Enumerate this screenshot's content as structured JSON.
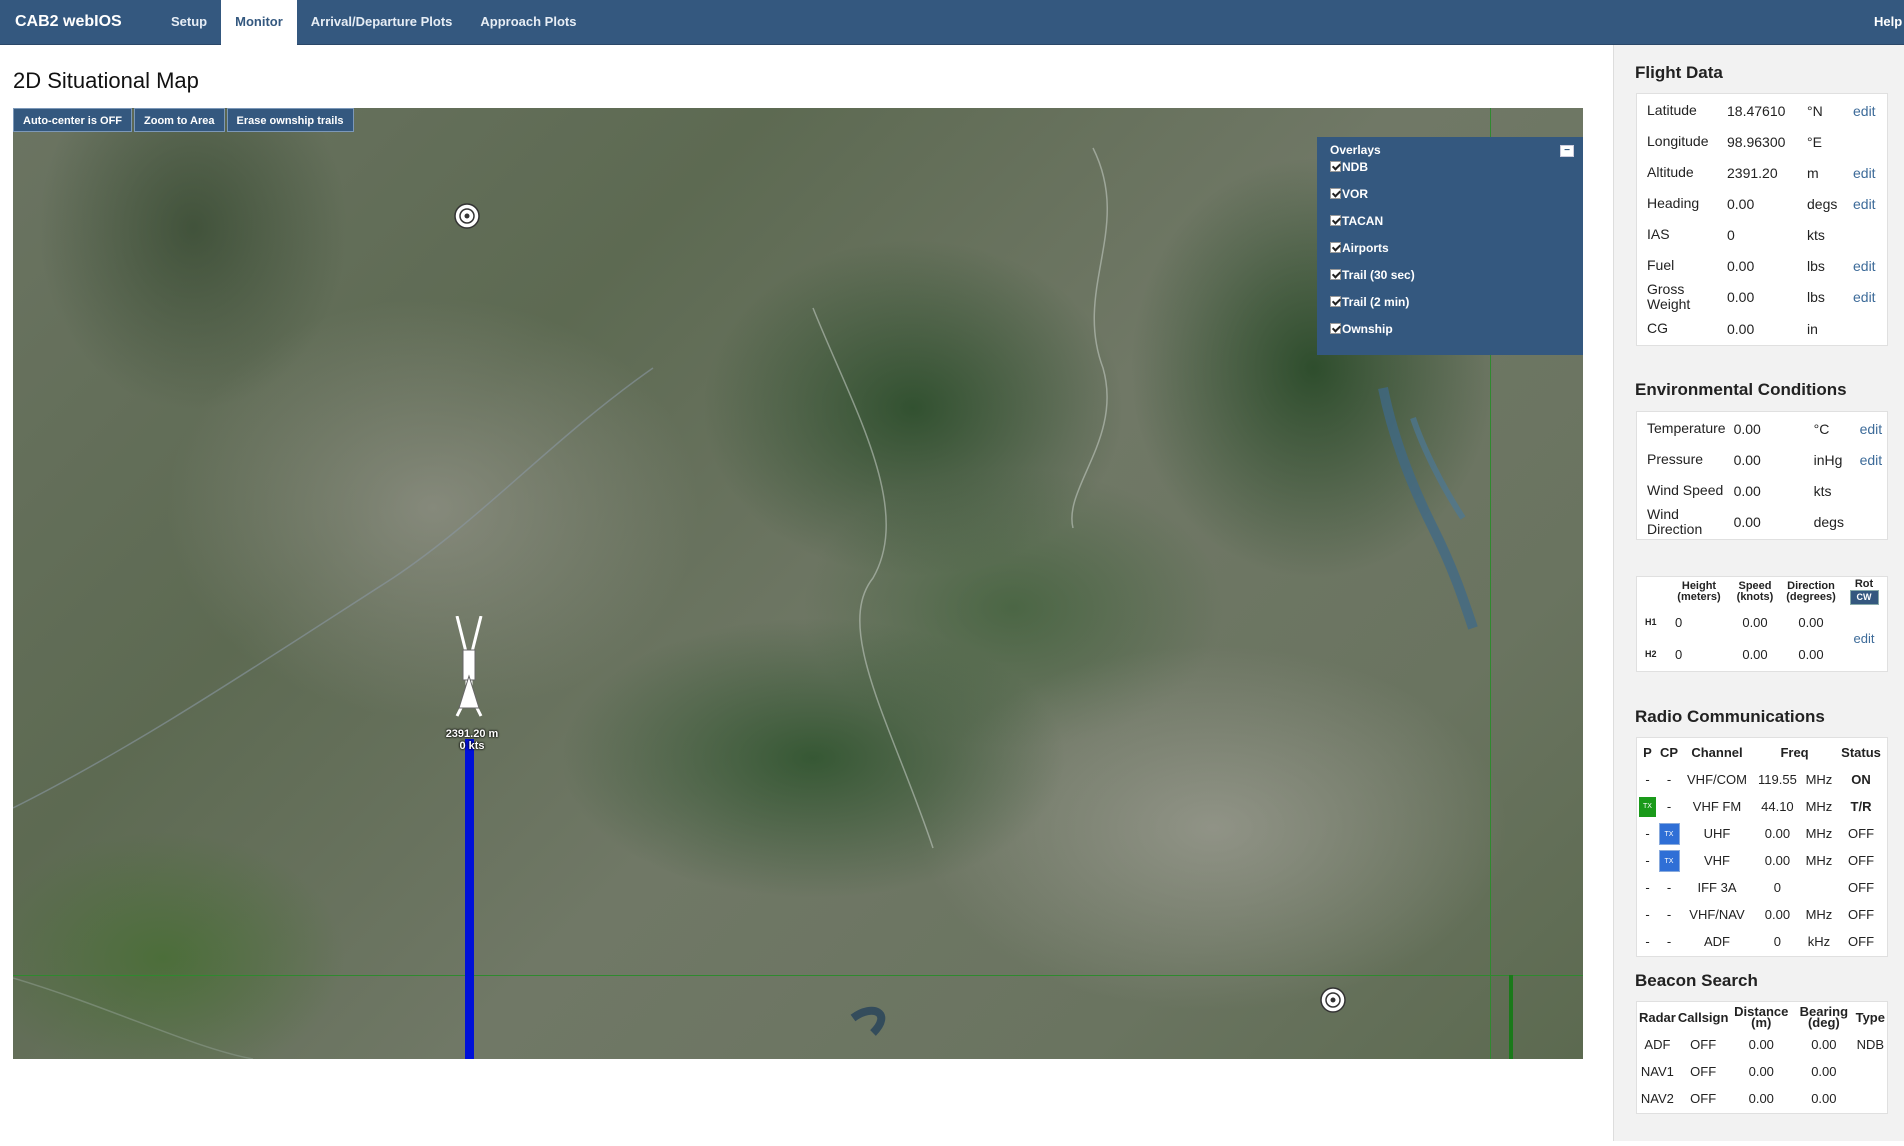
{
  "app": {
    "title": "CAB2 webIOS",
    "help": "Help"
  },
  "nav": {
    "tabs": [
      "Setup",
      "Monitor",
      "Arrival/Departure Plots",
      "Approach Plots"
    ],
    "active": "Monitor"
  },
  "page": {
    "title": "2D Situational Map"
  },
  "map": {
    "buttons": [
      "Auto-center is OFF",
      "Zoom to Area",
      "Erase ownship trails"
    ],
    "overlays": {
      "title": "Overlays",
      "items": [
        "NDB",
        "VOR",
        "TACAN",
        "Airports",
        "Trail (30 sec)",
        "Trail (2 min)",
        "Ownship"
      ]
    },
    "ownship": {
      "altitude": "2391.20 m",
      "speed": "0 kts"
    },
    "trail_color": "#0010d8"
  },
  "flight_data": {
    "title": "Flight Data",
    "rows": [
      {
        "label": "Latitude",
        "value": "18.47610",
        "unit": "°N",
        "edit": "edit"
      },
      {
        "label": "Longitude",
        "value": "98.96300",
        "unit": "°E",
        "edit": ""
      },
      {
        "label": "Altitude",
        "value": "2391.20",
        "unit": "m",
        "edit": "edit"
      },
      {
        "label": "Heading",
        "value": "0.00",
        "unit": "degs",
        "edit": "edit"
      },
      {
        "label": "IAS",
        "value": "0",
        "unit": "kts",
        "edit": ""
      },
      {
        "label": "Fuel",
        "value": "0.00",
        "unit": "lbs",
        "edit": "edit"
      },
      {
        "label": "Gross Weight",
        "value": "0.00",
        "unit": "lbs",
        "edit": "edit"
      },
      {
        "label": "CG",
        "value": "0.00",
        "unit": "in",
        "edit": ""
      }
    ]
  },
  "environment": {
    "title": "Environmental Conditions",
    "rows": [
      {
        "label": "Temperature",
        "value": "0.00",
        "unit": "°C",
        "edit": "edit"
      },
      {
        "label": "Pressure",
        "value": "0.00",
        "unit": "inHg",
        "edit": "edit"
      },
      {
        "label": "Wind Speed",
        "value": "0.00",
        "unit": "kts",
        "edit": ""
      },
      {
        "label": "Wind Direction",
        "value": "0.00",
        "unit": "degs",
        "edit": ""
      }
    ]
  },
  "wind_layers": {
    "headers": [
      "Height (meters)",
      "Speed (knots)",
      "Direction (degrees)",
      "Rot"
    ],
    "rot_button": "CW",
    "rows": [
      {
        "label": "H1",
        "height": "0",
        "speed": "0.00",
        "direction": "0.00"
      },
      {
        "label": "H2",
        "height": "0",
        "speed": "0.00",
        "direction": "0.00"
      }
    ],
    "edit": "edit"
  },
  "radio": {
    "title": "Radio Communications",
    "headers": [
      "P",
      "CP",
      "Channel",
      "Freq",
      "Status"
    ],
    "rows": [
      {
        "p": "-",
        "cp": "-",
        "channel": "VHF/COM",
        "freq": "119.55",
        "unit": "MHz",
        "status": "ON",
        "bold": true
      },
      {
        "p": "TX",
        "cp": "-",
        "channel": "VHF FM",
        "freq": "44.10",
        "unit": "MHz",
        "status": "T/R",
        "bold": true
      },
      {
        "p": "-",
        "cp": "TX",
        "channel": "UHF",
        "freq": "0.00",
        "unit": "MHz",
        "status": "OFF",
        "bold": false
      },
      {
        "p": "-",
        "cp": "TX",
        "channel": "VHF",
        "freq": "0.00",
        "unit": "MHz",
        "status": "OFF",
        "bold": false
      },
      {
        "p": "-",
        "cp": "-",
        "channel": "IFF 3A",
        "freq": "0",
        "unit": "",
        "status": "OFF",
        "bold": false
      },
      {
        "p": "-",
        "cp": "-",
        "channel": "VHF/NAV",
        "freq": "0.00",
        "unit": "MHz",
        "status": "OFF",
        "bold": false
      },
      {
        "p": "-",
        "cp": "-",
        "channel": "ADF",
        "freq": "0",
        "unit": "kHz",
        "status": "OFF",
        "bold": false
      }
    ]
  },
  "beacon": {
    "title": "Beacon Search",
    "headers": [
      "Radar",
      "Callsign",
      "Distance (m)",
      "Bearing (deg)",
      "Type"
    ],
    "rows": [
      {
        "radar": "ADF",
        "callsign": "OFF",
        "distance": "0.00",
        "bearing": "0.00",
        "type": "NDB"
      },
      {
        "radar": "NAV1",
        "callsign": "OFF",
        "distance": "0.00",
        "bearing": "0.00",
        "type": ""
      },
      {
        "radar": "NAV2",
        "callsign": "OFF",
        "distance": "0.00",
        "bearing": "0.00",
        "type": ""
      }
    ]
  }
}
